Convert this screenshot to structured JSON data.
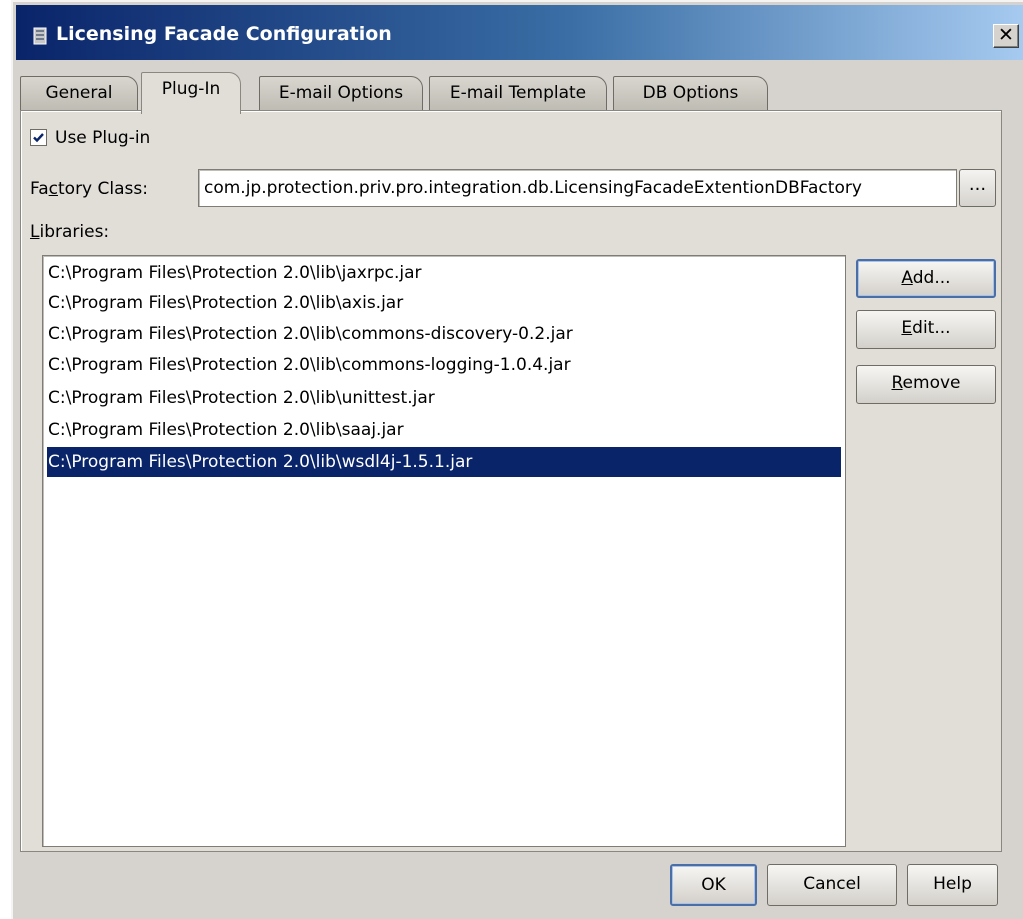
{
  "window": {
    "title": "Licensing Facade Configuration",
    "close_glyph": "✕",
    "icon": "app-icon"
  },
  "tabs": [
    {
      "label": "General",
      "active": false
    },
    {
      "label": "Plug-In",
      "active": true
    },
    {
      "label": "E-mail Options",
      "active": false
    },
    {
      "label": "E-mail Template",
      "active": false
    },
    {
      "label": "DB Options",
      "active": false
    }
  ],
  "plugin": {
    "use_plugin": {
      "label": "Use Plug-in",
      "checked": true
    },
    "factory": {
      "label_pre": "Fa",
      "label_mnemonic": "c",
      "label_post": "tory Class:",
      "value": "com.jp.protection.priv.pro.integration.db.LicensingFacadeExtentionDBFactory",
      "browse_label": "..."
    },
    "libraries": {
      "label_mnemonic": "L",
      "label_post": "ibraries:",
      "items": [
        "C:\\Program Files\\Protection 2.0\\lib\\jaxrpc.jar",
        "C:\\Program Files\\Protection 2.0\\lib\\axis.jar",
        "C:\\Program Files\\Protection 2.0\\lib\\commons-discovery-0.2.jar",
        "C:\\Program Files\\Protection 2.0\\lib\\commons-logging-1.0.4.jar",
        "C:\\Program Files\\Protection 2.0\\lib\\unittest.jar",
        "C:\\Program Files\\Protection 2.0\\lib\\saaj.jar",
        "C:\\Program Files\\Protection 2.0\\lib\\wsdl4j-1.5.1.jar"
      ],
      "selected_index": 6
    },
    "buttons": {
      "add": {
        "mnemonic": "A",
        "rest": "dd..."
      },
      "edit": {
        "mnemonic": "E",
        "rest": "dit..."
      },
      "remove": {
        "mnemonic": "R",
        "rest": "emove"
      }
    }
  },
  "footer": {
    "ok": "OK",
    "cancel": "Cancel",
    "help": "Help"
  },
  "colors": {
    "selection": "#0a246a",
    "dialog_bg": "#d6d3ce",
    "title_gradient_start": "#0a246a"
  }
}
